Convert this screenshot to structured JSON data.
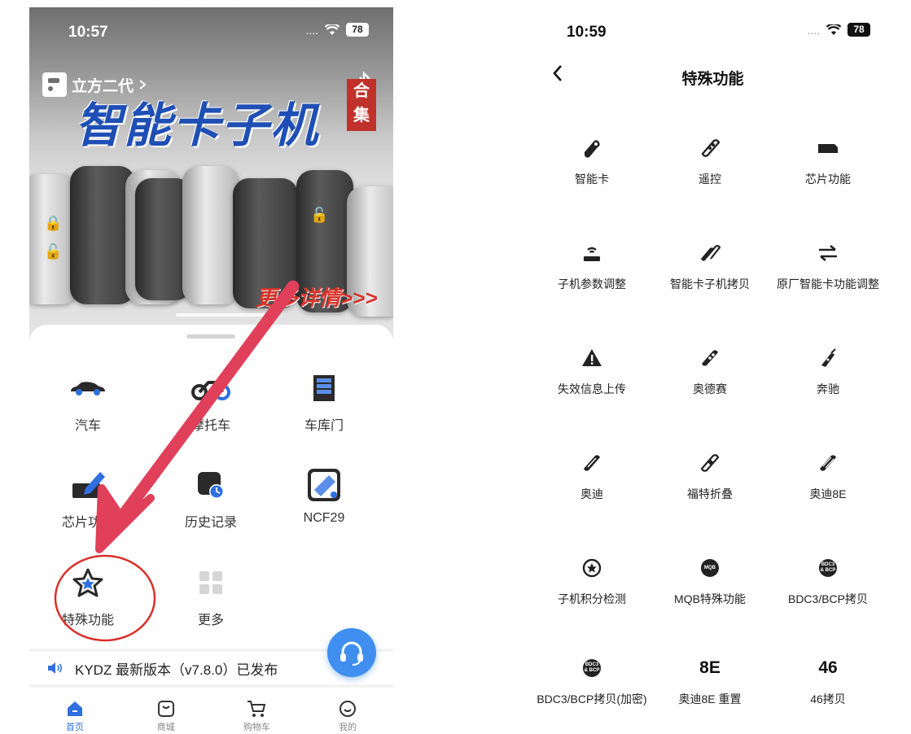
{
  "left": {
    "status": {
      "time": "10:57",
      "signal": "....",
      "battery": "78"
    },
    "device_name": "立方二代",
    "banner": {
      "title": "智能卡子机",
      "tag": "合集",
      "more_link": "更多详情>>>"
    },
    "grid": [
      {
        "label": "汽车",
        "icon": "car-icon"
      },
      {
        "label": "摩托车",
        "icon": "motorcycle-icon"
      },
      {
        "label": "车库门",
        "icon": "garage-door-icon"
      },
      {
        "label": "芯片功能",
        "icon": "chip-pen-icon"
      },
      {
        "label": "历史记录",
        "icon": "history-icon"
      },
      {
        "label": "NCF29",
        "icon": "ncf29-icon"
      },
      {
        "label": "特殊功能",
        "icon": "star-icon"
      },
      {
        "label": "更多",
        "icon": "more-grid-icon"
      }
    ],
    "notice": "KYDZ 最新版本（v7.8.0）已发布",
    "tabs": [
      {
        "label": "首页",
        "icon": "home-icon"
      },
      {
        "label": "商城",
        "icon": "shop-icon"
      },
      {
        "label": "购物车",
        "icon": "cart-icon"
      },
      {
        "label": "我的",
        "icon": "profile-icon"
      }
    ]
  },
  "right": {
    "status": {
      "time": "10:59",
      "signal": "....",
      "battery": "78"
    },
    "title": "特殊功能",
    "items": [
      {
        "label": "智能卡",
        "icon": "smart-card-icon"
      },
      {
        "label": "遥控",
        "icon": "remote-icon"
      },
      {
        "label": "芯片功能",
        "icon": "chip-icon"
      },
      {
        "label": "子机参数调整",
        "icon": "param-adjust-icon"
      },
      {
        "label": "智能卡子机拷贝",
        "icon": "copy-key-icon"
      },
      {
        "label": "原厂智能卡功能调整",
        "icon": "swap-arrows-icon"
      },
      {
        "label": "失效信息上传",
        "icon": "warning-icon"
      },
      {
        "label": "奥德赛",
        "icon": "odyssey-key-icon"
      },
      {
        "label": "奔驰",
        "icon": "benz-key-icon"
      },
      {
        "label": "奥迪",
        "icon": "audi-key-icon"
      },
      {
        "label": "福特折叠",
        "icon": "ford-flip-key-icon"
      },
      {
        "label": "奥迪8E",
        "icon": "audi8e-key-icon"
      },
      {
        "label": "子机积分检测",
        "icon": "points-check-icon"
      },
      {
        "label": "MQB特殊功能",
        "icon": "mqb-icon",
        "badge": "MQB"
      },
      {
        "label": "BDC3/BCP拷贝",
        "icon": "bdc3-icon",
        "badge": "BDC3 & BCP"
      },
      {
        "label": "BDC3/BCP拷贝(加密)",
        "icon": "bdc3-encrypted-icon",
        "badge": "BDC3 & BCP"
      },
      {
        "label": "奥迪8E 重置",
        "icon": "audi8e-reset-icon",
        "badge": "8E"
      },
      {
        "label": "46拷贝",
        "icon": "copy46-icon",
        "badge": "46"
      }
    ]
  },
  "colors": {
    "accent_blue": "#2f6fe0",
    "annotation_red": "#e0405a",
    "fab_blue": "#3f8ef0"
  }
}
